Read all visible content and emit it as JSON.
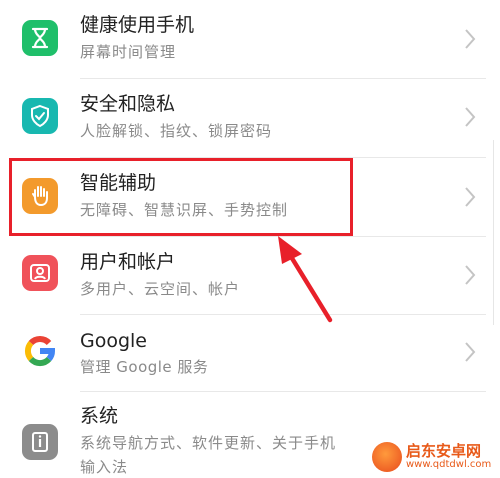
{
  "settings_list": [
    {
      "title": "健康使用手机",
      "subtitle": "屏幕时间管理",
      "icon": "hourglass-icon",
      "color": "#1fbf6a"
    },
    {
      "title": "安全和隐私",
      "subtitle": "人脸解锁、指纹、锁屏密码",
      "icon": "shield-check-icon",
      "color": "#18b8b0"
    },
    {
      "title": "智能辅助",
      "subtitle": "无障碍、智慧识屏、手势控制",
      "icon": "hand-icon",
      "color": "#f39a2c"
    },
    {
      "title": "用户和帐户",
      "subtitle": "多用户、云空间、帐户",
      "icon": "user-icon",
      "color": "#f0525a"
    },
    {
      "title": "Google",
      "subtitle": "管理 Google 服务",
      "icon": "google-icon",
      "color": "#ffffff"
    },
    {
      "title": "系统",
      "subtitle": "系统导航方式、软件更新、关于手机",
      "subtitle2": "输入法",
      "icon": "system-info-icon",
      "color": "#8c8c8c"
    }
  ],
  "annotation": {
    "color": "#e8202a",
    "target": "智能辅助"
  },
  "watermark": {
    "title": "启东安卓网",
    "url": "www.qdtdwl.com"
  }
}
